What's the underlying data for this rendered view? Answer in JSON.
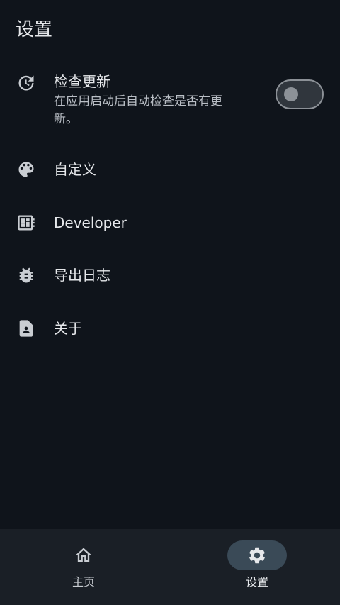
{
  "header": {
    "title": "设置"
  },
  "settings": {
    "check_update": {
      "label": "检查更新",
      "description": "在应用启动后自动检查是否有更新。",
      "enabled": false,
      "icon": "update-icon"
    },
    "customize": {
      "label": "自定义",
      "icon": "palette-icon"
    },
    "developer": {
      "label": "Developer",
      "icon": "developer-board-icon"
    },
    "export_logs": {
      "label": "导出日志",
      "icon": "bug-icon"
    },
    "about": {
      "label": "关于",
      "icon": "contact-page-icon"
    }
  },
  "bottom_nav": {
    "items": [
      {
        "label": "主页",
        "icon": "home-icon",
        "active": false
      },
      {
        "label": "设置",
        "icon": "gear-icon",
        "active": true
      }
    ]
  },
  "colors": {
    "background": "#0f141b",
    "nav_background": "#1a1f26",
    "active_indicator": "#3a4a57",
    "text_primary": "#e6e8eb",
    "text_secondary": "#b9bec5",
    "toggle_outline": "#8c9197"
  }
}
